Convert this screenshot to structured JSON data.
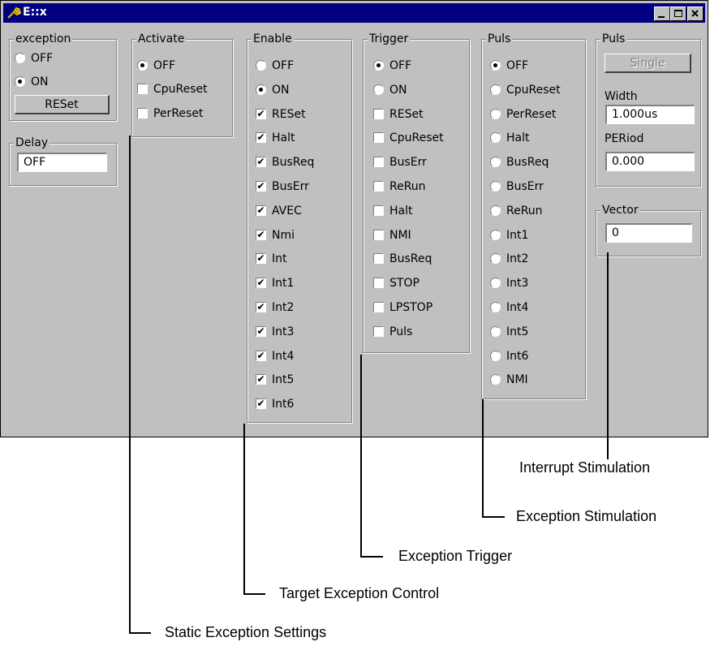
{
  "window": {
    "title": "E::x"
  },
  "groups": {
    "exception": {
      "label": "exception",
      "options": [
        {
          "label": "OFF",
          "checked": false
        },
        {
          "label": "ON",
          "checked": true
        }
      ],
      "button": "RESet"
    },
    "delay": {
      "label": "Delay",
      "value": "OFF"
    },
    "activate": {
      "label": "Activate",
      "radio": {
        "label": "OFF",
        "checked": true
      },
      "checks": [
        {
          "label": "CpuReset",
          "checked": false
        },
        {
          "label": "PerReset",
          "checked": false
        }
      ]
    },
    "enable": {
      "label": "Enable",
      "radios": [
        {
          "label": "OFF",
          "checked": false
        },
        {
          "label": "ON",
          "checked": true
        }
      ],
      "checks": [
        {
          "label": "RESet",
          "checked": true
        },
        {
          "label": "Halt",
          "checked": true
        },
        {
          "label": "BusReq",
          "checked": true
        },
        {
          "label": "BusErr",
          "checked": true
        },
        {
          "label": "AVEC",
          "checked": true
        },
        {
          "label": "Nmi",
          "checked": true
        },
        {
          "label": "Int",
          "checked": true
        },
        {
          "label": "Int1",
          "checked": true
        },
        {
          "label": "Int2",
          "checked": true
        },
        {
          "label": "Int3",
          "checked": true
        },
        {
          "label": "Int4",
          "checked": true
        },
        {
          "label": "Int5",
          "checked": true
        },
        {
          "label": "Int6",
          "checked": true
        }
      ]
    },
    "trigger": {
      "label": "Trigger",
      "radios": [
        {
          "label": "OFF",
          "checked": true
        },
        {
          "label": "ON",
          "checked": false
        }
      ],
      "checks": [
        {
          "label": "RESet",
          "checked": false
        },
        {
          "label": "CpuReset",
          "checked": false
        },
        {
          "label": "BusErr",
          "checked": false
        },
        {
          "label": "ReRun",
          "checked": false
        },
        {
          "label": "Halt",
          "checked": false
        },
        {
          "label": "NMI",
          "checked": false
        },
        {
          "label": "BusReq",
          "checked": false
        },
        {
          "label": "STOP",
          "checked": false
        },
        {
          "label": "LPSTOP",
          "checked": false
        },
        {
          "label": "Puls",
          "checked": false
        }
      ]
    },
    "puls": {
      "label": "Puls",
      "radios": [
        {
          "label": "OFF",
          "checked": true
        },
        {
          "label": "CpuReset",
          "checked": false
        },
        {
          "label": "PerReset",
          "checked": false
        },
        {
          "label": "Halt",
          "checked": false
        },
        {
          "label": "BusReq",
          "checked": false
        },
        {
          "label": "BusErr",
          "checked": false
        },
        {
          "label": "ReRun",
          "checked": false
        },
        {
          "label": "Int1",
          "checked": false
        },
        {
          "label": "Int2",
          "checked": false
        },
        {
          "label": "Int3",
          "checked": false
        },
        {
          "label": "Int4",
          "checked": false
        },
        {
          "label": "Int5",
          "checked": false
        },
        {
          "label": "Int6",
          "checked": false
        },
        {
          "label": "NMI",
          "checked": false
        }
      ]
    },
    "puls2": {
      "label": "Puls",
      "button": "Single"
    },
    "width": {
      "label": "Width",
      "value": "1.000us"
    },
    "period": {
      "label": "PERiod",
      "value": "0.000"
    },
    "vector": {
      "label": "Vector",
      "value": "0"
    }
  },
  "annotations": {
    "interrupt": "Interrupt Stimulation",
    "exception_stim": "Exception Stimulation",
    "trigger": "Exception Trigger",
    "target": "Target Exception Control",
    "static": "Static Exception Settings"
  },
  "colors": {
    "titlebar": "#000080",
    "face": "#c0c0c0"
  }
}
